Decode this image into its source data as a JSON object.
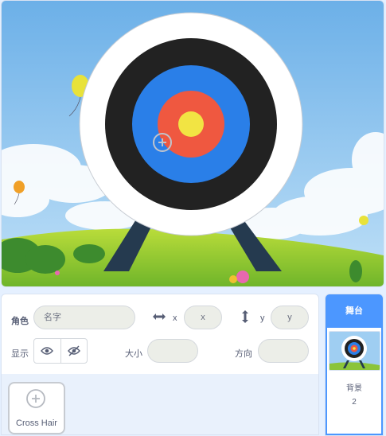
{
  "sprite_info": {
    "sprite_label": "角色",
    "name_placeholder": "名字",
    "x_label": "x",
    "x_placeholder": "x",
    "y_label": "y",
    "y_placeholder": "y",
    "show_label": "显示",
    "size_label": "大小",
    "direction_label": "方向",
    "size_value": "",
    "direction_value": ""
  },
  "sprites": [
    {
      "name": "Cross Hair"
    }
  ],
  "stage_pane": {
    "title": "舞台",
    "backdrops_label": "背景",
    "backdrop_count": "2"
  },
  "colors": {
    "accent": "#4c97ff",
    "target_yellow": "#f2e443",
    "target_red": "#ef5840",
    "target_blue": "#2a7fe8",
    "target_black": "#222222"
  },
  "icons": {
    "x_arrows": "horizontal-arrows-icon",
    "y_arrows": "vertical-arrows-icon",
    "show": "eye-icon",
    "hide": "eye-slash-icon",
    "crosshair": "crosshair-icon"
  }
}
